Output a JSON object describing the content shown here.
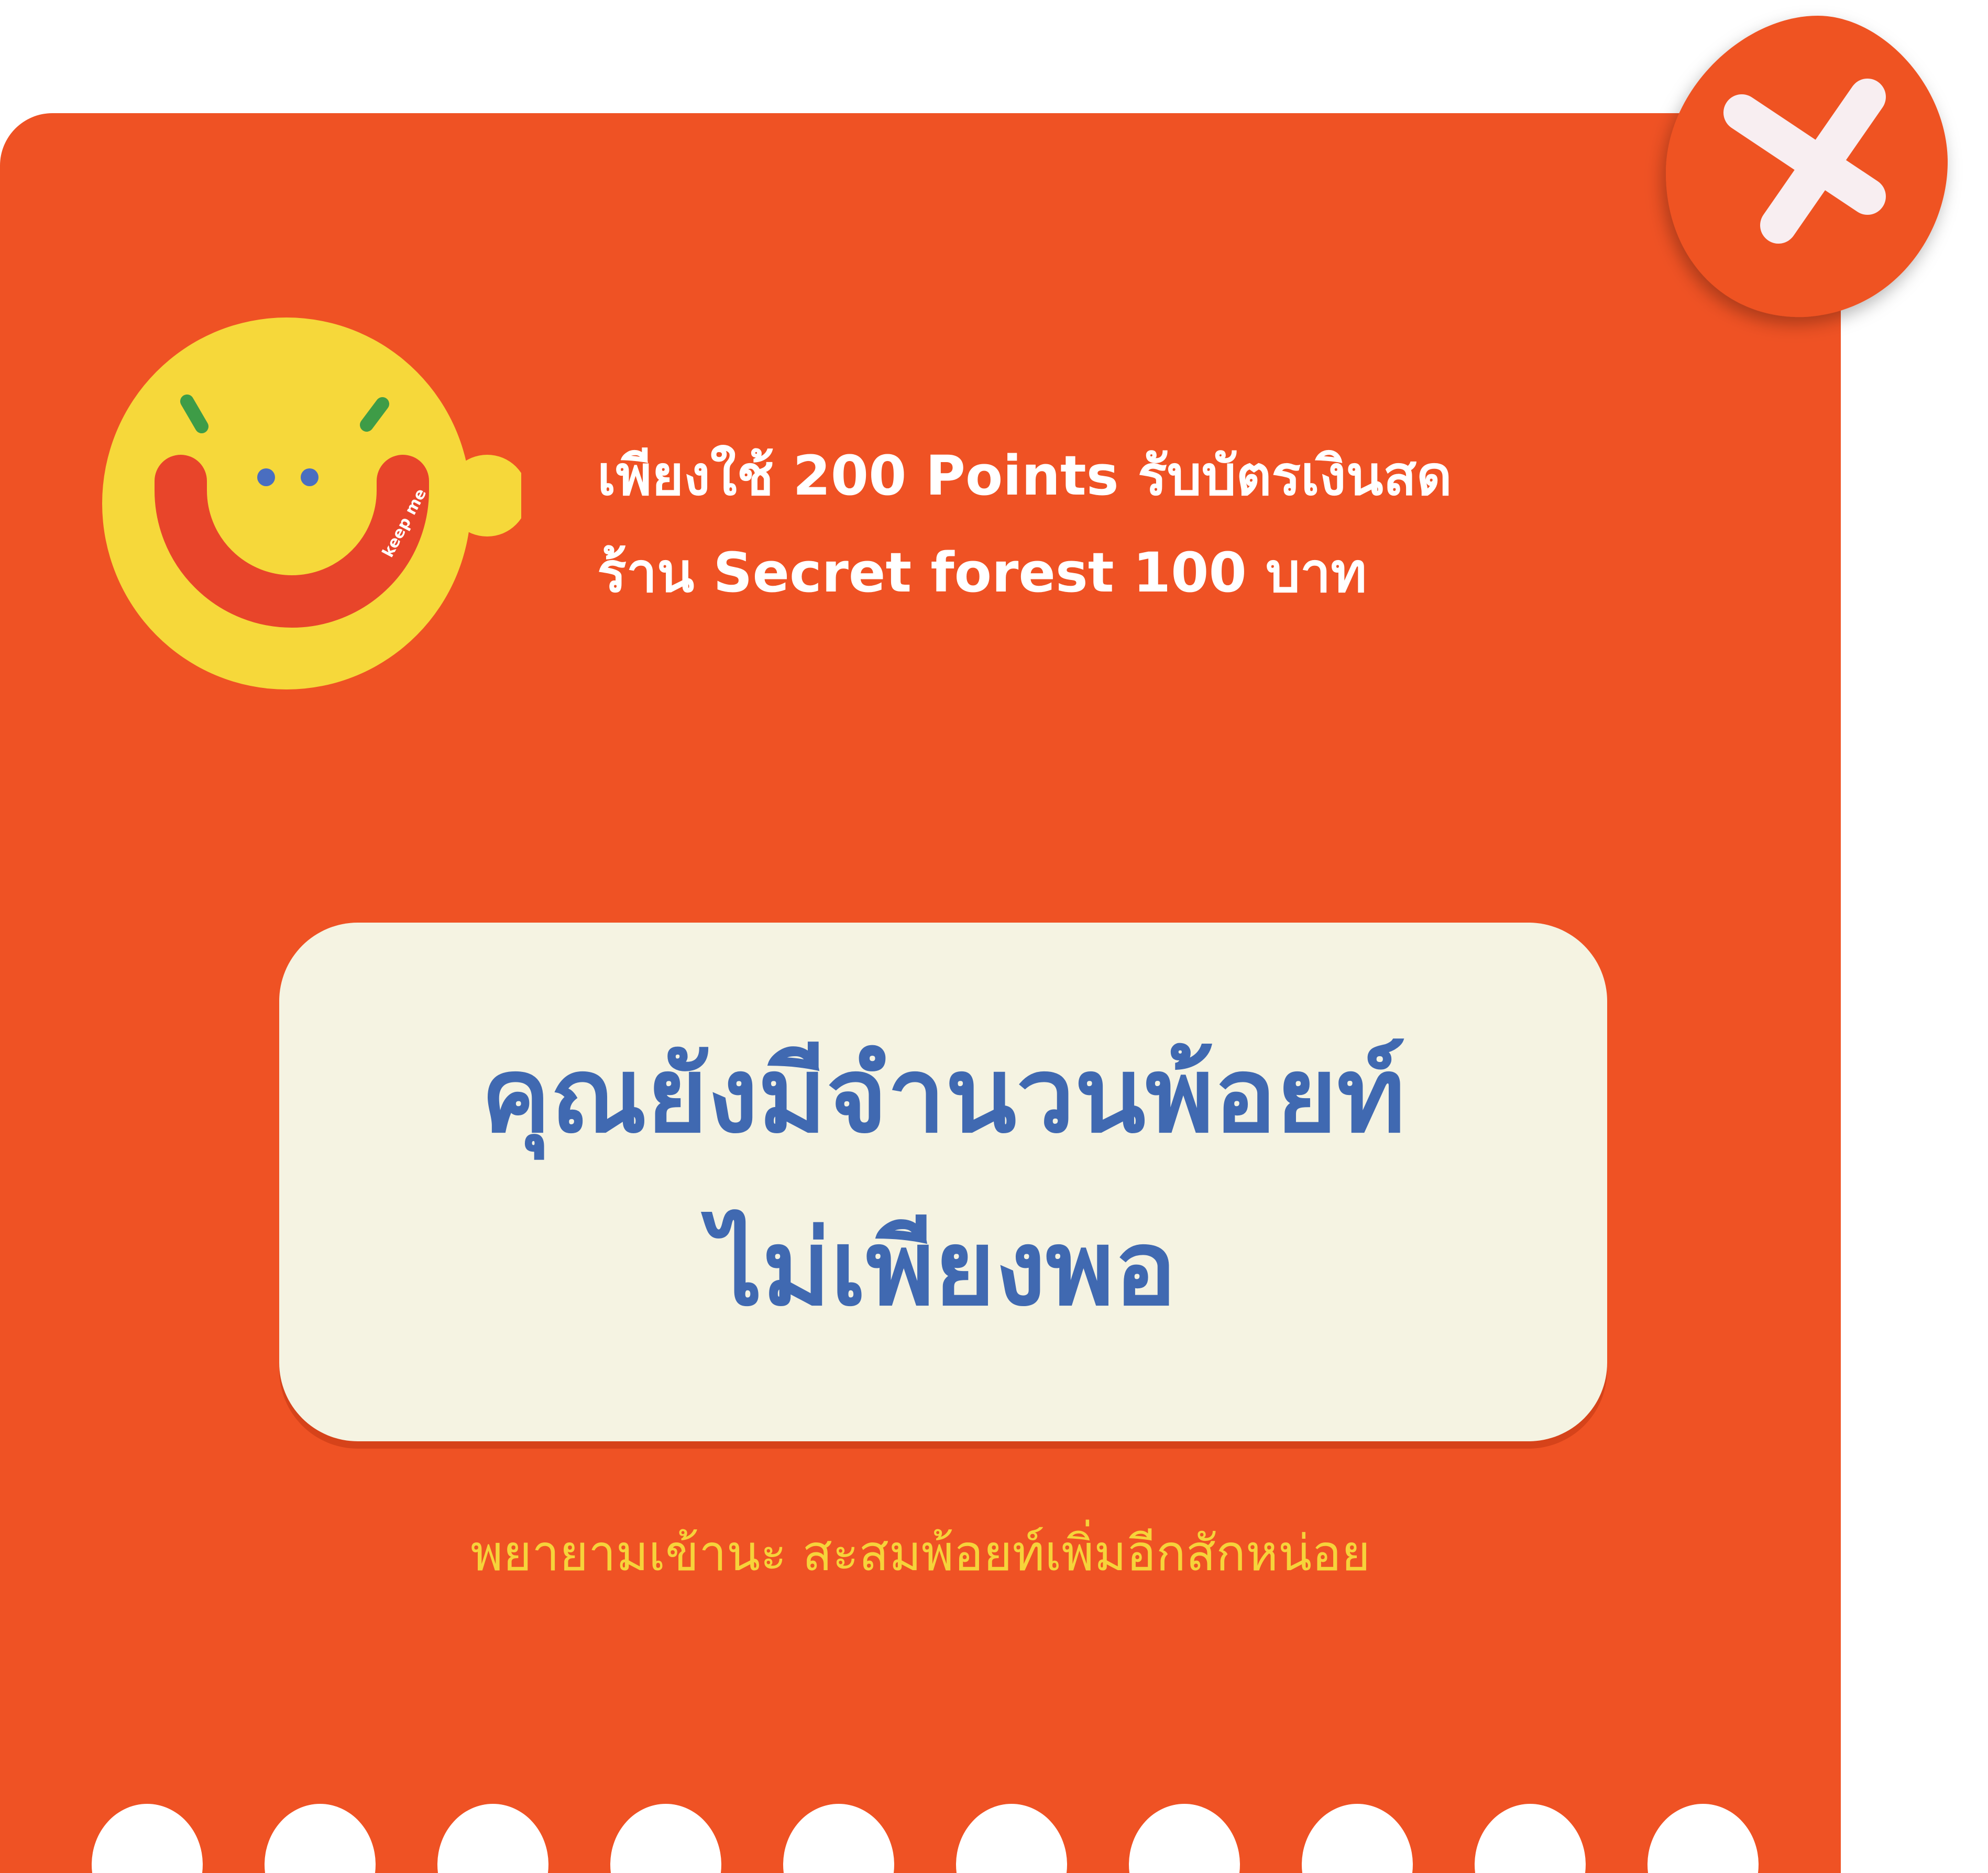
{
  "popup": {
    "headline_line1": "เพียงใช้ 200 Points รับบัตรเงินสด",
    "headline_line2": "ร้าน Secret forest 100 บาท",
    "message_line1": "คุณยังมีจำนวนพ้อยท์",
    "message_line2": "ไม่เพียงพอ",
    "hint": "พยายามเข้านะ  สะสมพ้อยท์เพิ่มอีกสักหน่อย",
    "mascot_text": "keep me",
    "close_icon": "close-icon"
  },
  "colors": {
    "card_background": "#EF5224",
    "message_box_background": "#F5F3E2",
    "message_text": "#4069B1",
    "hint_text": "#F6D33A",
    "mascot_face": "#F6D83A",
    "mascot_smile": "#E8452A",
    "mascot_brows": "#3E9C47",
    "mascot_eyes": "#4A6EC0",
    "close_button": "#EF5224",
    "close_glyph": "#F8EEF1",
    "scallop": "#FFFFFF"
  }
}
